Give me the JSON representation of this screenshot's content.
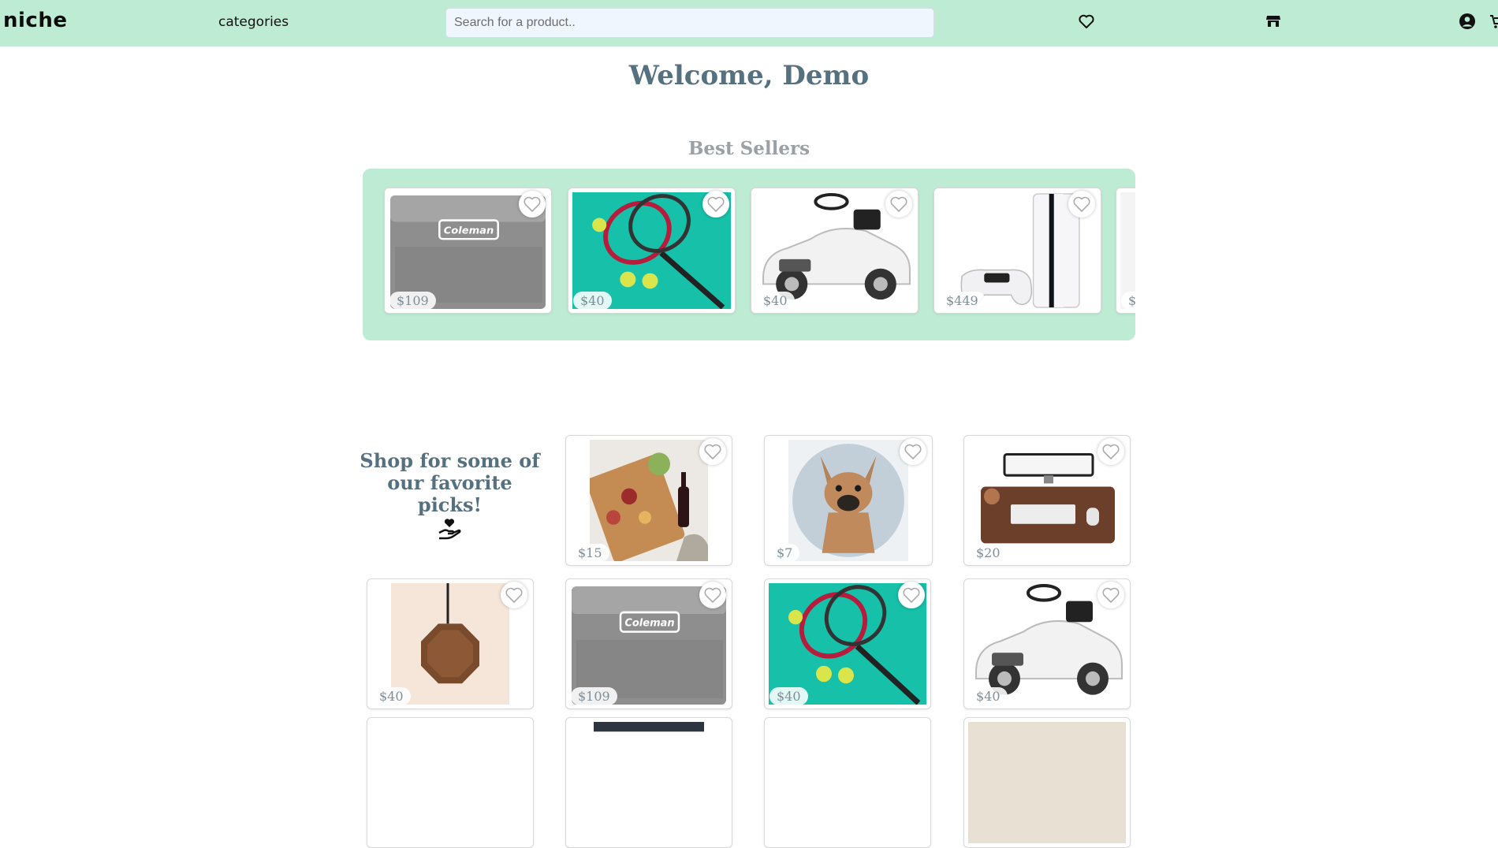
{
  "nav": {
    "logo": "niche",
    "categories_label": "categories",
    "search_placeholder": "Search for a product..",
    "icons": [
      "heart-icon",
      "store-icon",
      "user-icon",
      "cart-icon"
    ]
  },
  "welcome": "Welcome, Demo",
  "best_sellers": {
    "title": "Best Sellers",
    "items": [
      {
        "name": "cooler",
        "price": "$109"
      },
      {
        "name": "tennis-racket",
        "price": "$40"
      },
      {
        "name": "toy-car",
        "price": "$40"
      },
      {
        "name": "game-console",
        "price": "$449"
      },
      {
        "name": "partial",
        "price": "$"
      }
    ]
  },
  "favorites": {
    "title": "Shop for some of our favorite picks!",
    "icon": "heart-hand-icon",
    "items": [
      {
        "name": "charcuterie-board",
        "price": "$15"
      },
      {
        "name": "dog-portrait",
        "price": "$7"
      },
      {
        "name": "desk-mat",
        "price": "$20"
      },
      {
        "name": "wireless-charger",
        "price": "$40"
      },
      {
        "name": "cooler",
        "price": "$109"
      },
      {
        "name": "tennis-racket",
        "price": "$40"
      },
      {
        "name": "toy-car",
        "price": "$40"
      }
    ]
  },
  "colors": {
    "accent": "#bdebd3",
    "heading": "#55707f",
    "subheading": "#9aa0a6",
    "price_text": "#7f8e99"
  }
}
